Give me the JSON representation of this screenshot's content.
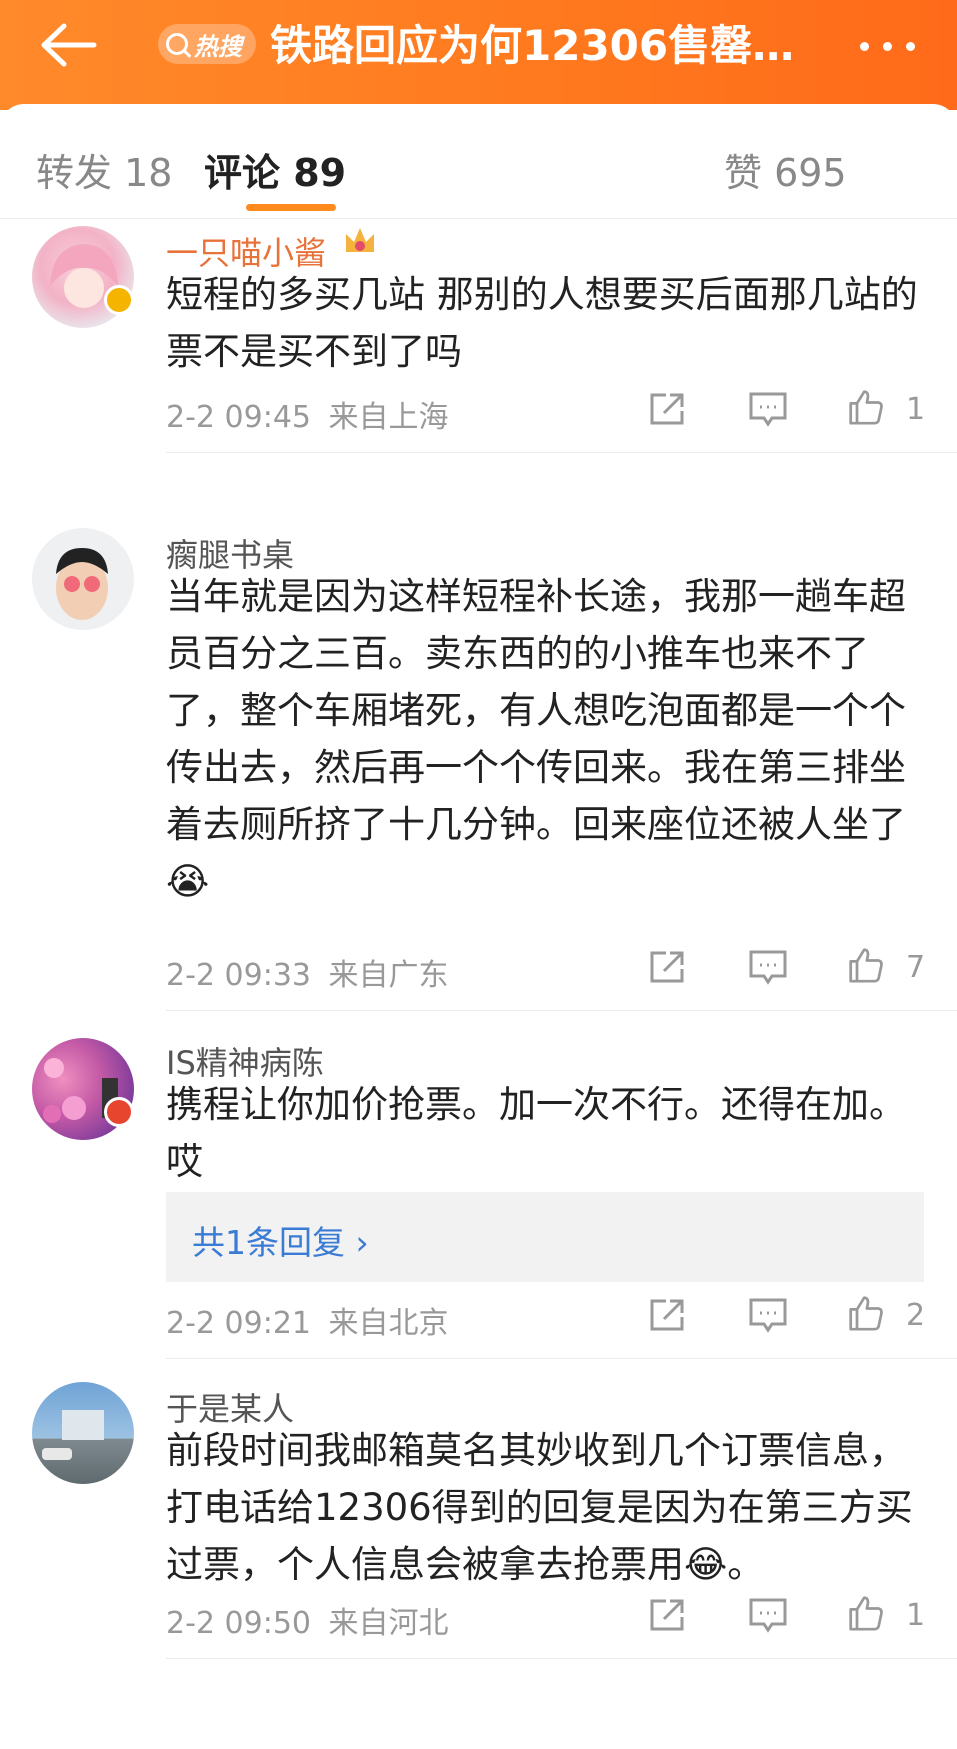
{
  "header": {
    "back_icon": "back-arrow-icon",
    "hot_badge": "热搜",
    "title": "铁路回应为何12306售罄…",
    "more_icon": "more-dots-icon",
    "colors": {
      "bar_start": "#ff8a2b",
      "bar_end": "#ff6a1a"
    }
  },
  "tabs": {
    "repost": "转发 18",
    "comments": "评论 89",
    "likes": "赞 695",
    "accent": "#ff8a1e"
  },
  "comments": [
    {
      "username": "一只喵小酱",
      "badge": "crown-icon",
      "verified": "gold",
      "text": "短程的多买几站 那别的人想要买后面那几站的票不是买不到了吗",
      "time": "2-2 09:45",
      "location": "来自上海",
      "likes": "1"
    },
    {
      "username": "瘸腿书桌",
      "text": "当年就是因为这样短程补长途，我那一趟车超员百分之三百。卖东西的的小推车也来不了了，整个车厢堵死，有人想吃泡面都是一个个传出去，然后再一个个传回来。我在第三排坐着去厕所挤了十几分钟。回来座位还被人坐了😭",
      "time": "2-2 09:33",
      "location": "来自广东",
      "likes": "7"
    },
    {
      "username": "IS精神病陈",
      "verified": "red",
      "text": "携程让你加价抢票。加一次不行。还得在加。哎",
      "reply_summary": "共1条回复 ›",
      "time": "2-2 09:21",
      "location": "来自北京",
      "likes": "2"
    },
    {
      "username": "于是某人",
      "text": "前段时间我邮箱莫名其妙收到几个订票信息，打电话给12306得到的回复是因为在第三方买过票，个人信息会被拿去抢票用😂。",
      "time": "2-2 09:50",
      "location": "来自河北",
      "likes": "1"
    }
  ],
  "action_icons": [
    "share-icon",
    "comment-icon",
    "like-icon"
  ]
}
